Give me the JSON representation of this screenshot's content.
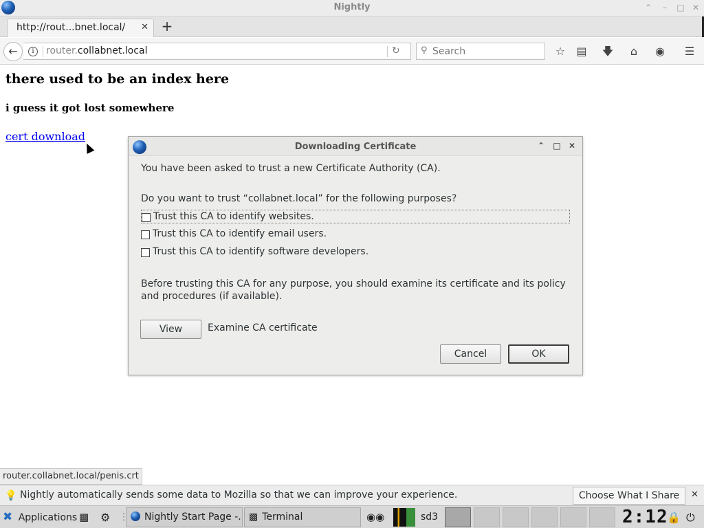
{
  "window": {
    "title": "Nightly"
  },
  "tabs": [
    {
      "title": "http://rout...bnet.local/"
    }
  ],
  "navbar": {
    "url_prefix": "router.",
    "url_domain": "collabnet.local",
    "search_placeholder": "Search"
  },
  "page": {
    "heading": "there used to be an index here",
    "subheading": "i guess it got lost somewhere",
    "link_text": "cert download"
  },
  "dialog": {
    "title": "Downloading Certificate",
    "intro": "You have been asked to trust a new Certificate Authority (CA).",
    "question": "Do you want to trust “collabnet.local” for the following purposes?",
    "options": [
      {
        "label": "Trust this CA to identify websites.",
        "checked": false
      },
      {
        "label": "Trust this CA to identify email users.",
        "checked": false
      },
      {
        "label": "Trust this CA to identify software developers.",
        "checked": false
      }
    ],
    "warning": "Before trusting this CA for any purpose, you should examine its certificate and its policy and procedures (if available).",
    "view_button": "View",
    "view_caption": "Examine CA certificate",
    "cancel_button": "Cancel",
    "ok_button": "OK"
  },
  "status": {
    "hover_url": "router.collabnet.local/penis.crt"
  },
  "notification": {
    "message": "Nightly automatically sends some data to Mozilla so that we can improve your experience.",
    "button": "Choose What I Share"
  },
  "taskbar": {
    "menu_label": "Applications",
    "tasks": [
      "Nightly Start Page -...",
      "Terminal"
    ],
    "workspace_label": "sd3",
    "clock": "2:12"
  }
}
